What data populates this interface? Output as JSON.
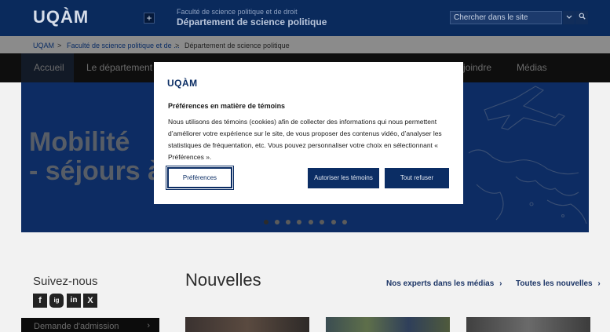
{
  "header": {
    "logo": "UQÀM",
    "plus_label": "+",
    "faculty": "Faculté de science politique et de droit",
    "department": "Département de science politique",
    "search_placeholder": "Chercher dans le site",
    "scope_icon": "chevron-down-icon",
    "search_icon": "search-icon"
  },
  "breadcrumb": {
    "items": [
      "UQAM",
      "Faculté de science politique et de ...",
      "Département de science politique"
    ],
    "separator": ">"
  },
  "nav": {
    "items": [
      "Accueil",
      "Le département",
      "joindre",
      "Médias"
    ],
    "active": "Accueil"
  },
  "hero": {
    "line1": "Mobilité",
    "line2": "- séjours à",
    "slide_count": 8,
    "active_slide": 1
  },
  "sidebar": {
    "follow_title": "Suivez-nous",
    "social": [
      "f",
      "ig",
      "in",
      "X"
    ],
    "admission_label": "Demande d'admission",
    "admission_chevron": "›"
  },
  "news": {
    "title": "Nouvelles",
    "experts_link": "Nos experts dans les médias",
    "all_link": "Toutes les nouvelles",
    "chevron": "›"
  },
  "cookie_modal": {
    "logo": "UQÀM",
    "title": "Préférences en matière de témoins",
    "body": "Nous utilisons des témoins (cookies) afin de collecter des informations qui nous permettent d’améliorer votre expérience sur le site, de vous proposer des contenus vidéo, d’analyser les statistiques de fréquentation, etc. Vous pouvez personnaliser votre choix en sélectionnant « Préférences ».",
    "preferences_button": "Préférences",
    "allow_button": "Autoriser les témoins",
    "refuse_button": "Tout refuser"
  },
  "colors": {
    "brand_navy": "#0b2d64",
    "header_bg": "#0a2a5c",
    "nav_bg": "#0e0e0e"
  }
}
